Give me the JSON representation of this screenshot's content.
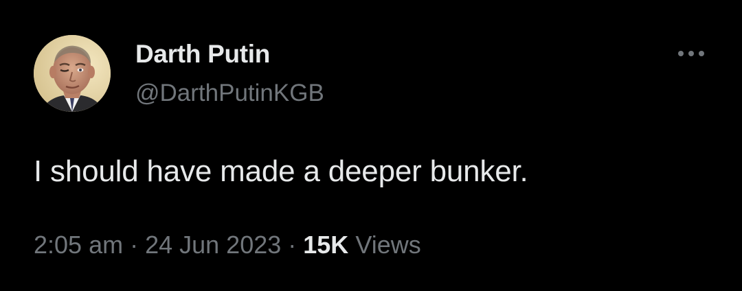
{
  "tweet": {
    "author": {
      "display_name": "Darth Putin",
      "handle": "@DarthPutinKGB",
      "avatar_icon": "profile-photo"
    },
    "more_icon": "more-horizontal-icon",
    "text": "I should have made a deeper bunker.",
    "time": "2:05 am",
    "date": "24 Jun 2023",
    "separator": "·",
    "views_count": "15K",
    "views_label": "Views"
  },
  "colors": {
    "background": "#000000",
    "primary_text": "#e7e9ea",
    "secondary_text": "#71767b"
  }
}
